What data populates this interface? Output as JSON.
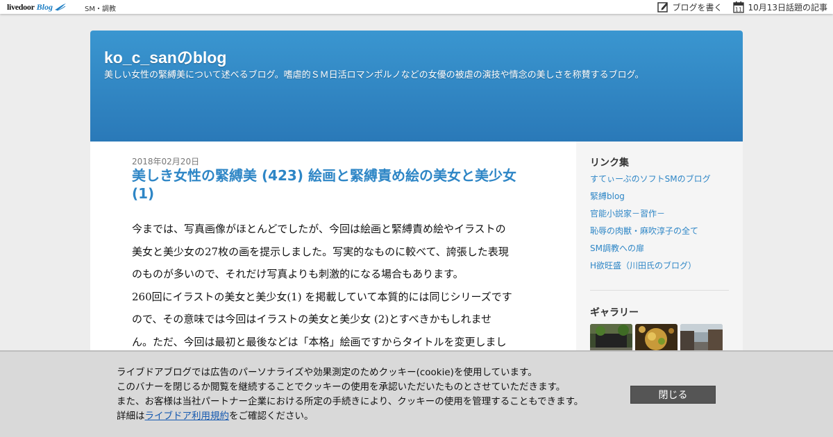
{
  "topbar": {
    "logo_livedoor": "livedoor",
    "logo_blog": "Blog",
    "category": "SM・調教",
    "write_label": "ブログを書く",
    "calendar_day": "11",
    "trending_label": "10月13日話題の記事"
  },
  "blog": {
    "title": "ko_c_sanのblog",
    "description": "美しい女性の緊縛美について述べるブログ。嗜虐的ＳＭ日活ロマンポルノなどの女優の被虐の演技や情念の美しさを称賛するブログ。"
  },
  "post": {
    "date": "2018年02月20日",
    "title": "美しき女性の緊縛美 (423) 絵画と緊縛責め絵の美女と美少女 (1)",
    "body_lines": [
      "今までは、写真画像がほとんどでしたが、今回は絵画と緊縛責め絵やイラストの",
      "美女と美少女の27枚の画を提示しました。写実的なものに較べて、誇張した表現",
      "のものが多いので、それだけ写真よりも刺激的になる場合もあります。",
      "260回にイラストの美女と美少女(1) を掲載していて本質的には同じシリーズです",
      "ので、その意味では今回はイラストの美女と美少女 (2)とすべきかもしれませ",
      "ん。ただ、今回は最初と最後などは「本格」絵画ですからタイトルを変更しまし"
    ]
  },
  "sidebar": {
    "links_heading": "リンク集",
    "links": [
      "すてぃーぶのソフトSMのブログ",
      "緊縛blog",
      "官能小説家－習作－",
      "恥辱の肉獣・麻吹淳子の全て",
      "SM調教への扉",
      "H欲旺盛（川田氏のブログ）"
    ],
    "gallery_heading": "ギャラリー"
  },
  "cookie": {
    "line1": "ライブドアブログでは広告のパーソナライズや効果測定のためクッキー(cookie)を使用しています。",
    "line2": "このバナーを閉じるか閲覧を継続することでクッキーの使用を承認いただいたものとさせていただきます。",
    "line3": "また、お客様は当社パートナー企業における所定の手続きにより、クッキーの使用を管理することもできます。",
    "line4_prefix": "詳細は",
    "line4_link": "ライブドア利用規約",
    "line4_suffix": "をご確認ください。",
    "close_label": "閉じる"
  },
  "colors": {
    "header_blue": "#2a79b8",
    "link_blue": "#2e86c6",
    "close_button": "#555555"
  }
}
